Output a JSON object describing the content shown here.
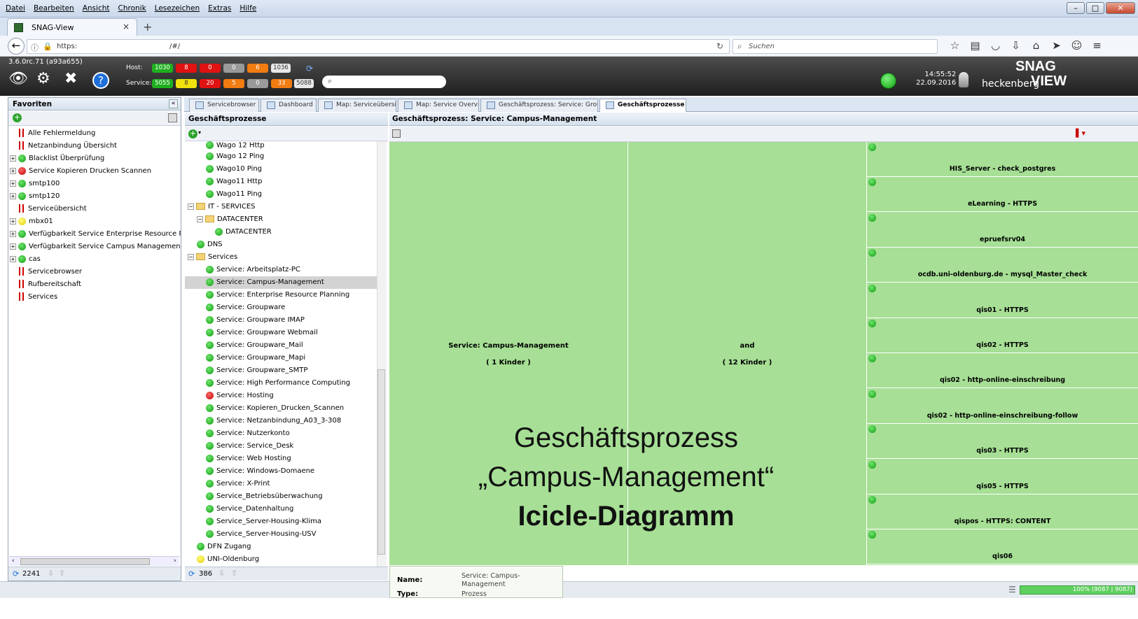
{
  "menu": [
    "Datei",
    "Bearbeiten",
    "Ansicht",
    "Chronik",
    "Lesezeichen",
    "Extras",
    "Hilfe"
  ],
  "browser": {
    "tab_title": "SNAG-View",
    "url_scheme": "https:",
    "url_path": "/#/",
    "search_placeholder": "Suchen"
  },
  "header": {
    "version": "3.6.0rc.71 (a93a655)",
    "host_label": "Host:",
    "service_label": "Service:",
    "host_counts": [
      "1030",
      "8",
      "0",
      "0",
      "6",
      "1036"
    ],
    "service_counts": [
      "5055",
      "8",
      "20",
      "5",
      "0",
      "33",
      "5088"
    ],
    "time": "14:55:52",
    "date": "22.09.2016",
    "user": "heckenberg",
    "logo_top": "SNAG",
    "logo_bottom": "VIEW"
  },
  "favorites": {
    "title": "Favoriten",
    "items": [
      {
        "label": "Alle Fehlermeldung",
        "type": "flag",
        "exp": false
      },
      {
        "label": "Netzanbindung Übersicht",
        "type": "flag",
        "exp": false
      },
      {
        "label": "Blacklist Überprüfung",
        "type": "green",
        "exp": true
      },
      {
        "label": "Service Kopieren Drucken Scannen",
        "type": "red",
        "exp": true
      },
      {
        "label": "smtp100",
        "type": "green",
        "exp": true
      },
      {
        "label": "smtp120",
        "type": "green",
        "exp": true
      },
      {
        "label": "Serviceübersicht",
        "type": "flag",
        "exp": false
      },
      {
        "label": "mbx01",
        "type": "yellow",
        "exp": true
      },
      {
        "label": "Verfügbarkeit Service Enterprise Resource Pla",
        "type": "green",
        "exp": true
      },
      {
        "label": "Verfügbarkeit Service Campus Management",
        "type": "green",
        "exp": true
      },
      {
        "label": "cas",
        "type": "green",
        "exp": true
      },
      {
        "label": "Servicebrowser",
        "type": "flag",
        "exp": false
      },
      {
        "label": "Rufbereitschaft",
        "type": "flag",
        "exp": false
      },
      {
        "label": "Services",
        "type": "flag",
        "exp": false
      }
    ],
    "count": "2241"
  },
  "tabs": [
    {
      "label": "Servicebrowser",
      "active": false
    },
    {
      "label": "Dashboard",
      "active": false
    },
    {
      "label": "Map: Serviceübersicht",
      "active": false
    },
    {
      "label": "Map: Service Overview",
      "active": false
    },
    {
      "label": "Geschäftsprozess: Service: Groupware",
      "active": false
    },
    {
      "label": "Geschäftsprozesse",
      "active": true
    }
  ],
  "processes": {
    "title": "Geschäftsprozesse",
    "count": "386",
    "rows": [
      {
        "label": "Wago 12 Http",
        "indent": 2,
        "kind": "green"
      },
      {
        "label": "Wago 12 Ping",
        "indent": 2,
        "kind": "green"
      },
      {
        "label": "Wago10 Ping",
        "indent": 2,
        "kind": "green"
      },
      {
        "label": "Wago11 Http",
        "indent": 2,
        "kind": "green"
      },
      {
        "label": "Wago11 Ping",
        "indent": 2,
        "kind": "green"
      },
      {
        "label": "IT - SERVICES",
        "indent": 0,
        "kind": "folder"
      },
      {
        "label": "DATACENTER",
        "indent": 1,
        "kind": "folder"
      },
      {
        "label": "DATACENTER",
        "indent": 3,
        "kind": "green"
      },
      {
        "label": "DNS",
        "indent": 1,
        "kind": "green"
      },
      {
        "label": "Services",
        "indent": 0,
        "kind": "folder"
      },
      {
        "label": "Service: Arbeitsplatz-PC",
        "indent": 2,
        "kind": "green"
      },
      {
        "label": "Service: Campus-Management",
        "indent": 2,
        "kind": "green",
        "selected": true
      },
      {
        "label": "Service: Enterprise Resource Planning",
        "indent": 2,
        "kind": "green"
      },
      {
        "label": "Service: Groupware",
        "indent": 2,
        "kind": "green"
      },
      {
        "label": "Service: Groupware IMAP",
        "indent": 2,
        "kind": "green"
      },
      {
        "label": "Service: Groupware Webmail",
        "indent": 2,
        "kind": "green"
      },
      {
        "label": "Service: Groupware_Mail",
        "indent": 2,
        "kind": "green"
      },
      {
        "label": "Service: Groupware_Mapi",
        "indent": 2,
        "kind": "green"
      },
      {
        "label": "Service: Groupware_SMTP",
        "indent": 2,
        "kind": "green"
      },
      {
        "label": "Service: High Performance Computing",
        "indent": 2,
        "kind": "green"
      },
      {
        "label": "Service: Hosting",
        "indent": 2,
        "kind": "red"
      },
      {
        "label": "Service: Kopieren_Drucken_Scannen",
        "indent": 2,
        "kind": "green"
      },
      {
        "label": "Service: Netzanbindung_A03_3-308",
        "indent": 2,
        "kind": "green"
      },
      {
        "label": "Service: Nutzerkonto",
        "indent": 2,
        "kind": "green"
      },
      {
        "label": "Service: Service_Desk",
        "indent": 2,
        "kind": "green"
      },
      {
        "label": "Service: Web Hosting",
        "indent": 2,
        "kind": "green"
      },
      {
        "label": "Service: Windows-Domaene",
        "indent": 2,
        "kind": "green"
      },
      {
        "label": "Service: X-Print",
        "indent": 2,
        "kind": "green"
      },
      {
        "label": "Service_Betriebsüberwachung",
        "indent": 2,
        "kind": "green"
      },
      {
        "label": "Service_Datenhaltung",
        "indent": 2,
        "kind": "green"
      },
      {
        "label": "Service_Server-Housing-Klima",
        "indent": 2,
        "kind": "green"
      },
      {
        "label": "Service_Server-Housing-USV",
        "indent": 2,
        "kind": "green"
      },
      {
        "label": "DFN Zugang",
        "indent": 1,
        "kind": "green"
      },
      {
        "label": "UNI-Oldenburg",
        "indent": 1,
        "kind": "yellow"
      }
    ]
  },
  "icicle": {
    "title": "Geschäftsprozess: Service: Campus-Management",
    "root_label": "Service: Campus-Management",
    "root_children": "( 1 Kinder )",
    "op_label": "and",
    "op_children": "( 12 Kinder )",
    "leaves": [
      "HIS_Server - check_postgres",
      "eLearning - HTTPS",
      "epruefsrv04",
      "ocdb.uni-oldenburg.de - mysql_Master_check",
      "qis01 - HTTPS",
      "qis02 - HTTPS",
      "qis02 - http-online-einschreibung",
      "qis02 - http-online-einschreibung-follow",
      "qis03 - HTTPS",
      "qis05 - HTTPS",
      "qispos - HTTPS: CONTENT",
      "qis06"
    ],
    "overlay_line1": "Geschäftsprozess",
    "overlay_line2": "„Campus-Management“",
    "overlay_line3": "Icicle-Diagramm"
  },
  "info": {
    "name_label": "Name:",
    "name_value": "Service: Campus-Management",
    "type_label": "Type:",
    "type_value": "Prozess"
  },
  "status": {
    "progress_text": "100% (9087 | 9087)",
    "progress_fraction": 1.0
  }
}
